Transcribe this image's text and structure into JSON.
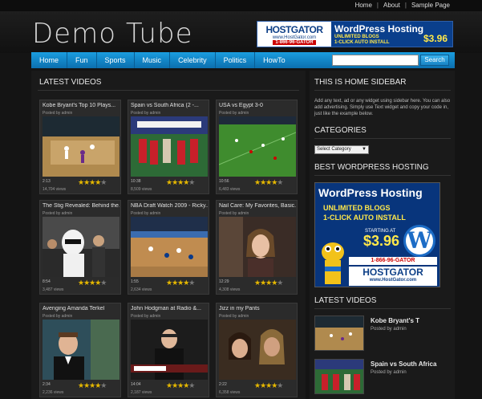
{
  "top_links": [
    "Home",
    "About",
    "Sample Page"
  ],
  "site_title": "Demo Tube",
  "header_ad": {
    "brand": "HOSTGATOR",
    "url": "www.HostGator.com",
    "phone": "1-866-96-GATOR",
    "title": "WordPress Hosting",
    "line1": "UNLIMITED BLOGS",
    "line2": "1-CLICK AUTO INSTALL",
    "price": "$3.96"
  },
  "nav": {
    "items": [
      "Home",
      "Fun",
      "Sports",
      "Music",
      "Celebrity",
      "Politics",
      "HowTo"
    ],
    "search_value": "",
    "search_button": "Search"
  },
  "main": {
    "section_title": "LATEST VIDEOS",
    "videos": [
      {
        "title": "Kobe Bryant's Top 10 Plays...",
        "posted": "Posted by admin",
        "duration": "2:13",
        "views": "14,704 views",
        "rating": 4
      },
      {
        "title": "Spain vs South Africa (2 -...",
        "posted": "Posted by admin",
        "duration": "10:38",
        "views": "8,509 views",
        "rating": 4
      },
      {
        "title": "USA vs Egypt 3-0",
        "posted": "Posted by admin",
        "duration": "10:56",
        "views": "6,483 views",
        "rating": 4
      },
      {
        "title": "The Stig Revealed: Behind the...",
        "posted": "Posted by admin",
        "duration": "8:54",
        "views": "3,487 views",
        "rating": 4
      },
      {
        "title": "NBA Draft Watch 2009 - Ricky...",
        "posted": "Posted by admin",
        "duration": "1:55",
        "views": "2,634 views",
        "rating": 4
      },
      {
        "title": "Nail Care: My Favorites, Basic...",
        "posted": "Posted by admin",
        "duration": "12:29",
        "views": "4,308 views",
        "rating": 4
      },
      {
        "title": "Avenging Amanda Terkel",
        "posted": "Posted by admin",
        "duration": "2:34",
        "views": "2,236 views",
        "rating": 4
      },
      {
        "title": "John Hodgman at Radio &...",
        "posted": "Posted by admin",
        "duration": "14:04",
        "views": "2,187 views",
        "rating": 4
      },
      {
        "title": "Jizz in my Pants",
        "posted": "Posted by admin",
        "duration": "2:22",
        "views": "6,358 views",
        "rating": 4
      }
    ]
  },
  "sidebar": {
    "home_title": "THIS IS HOME SIDEBAR",
    "home_text": "Add any text, ad or any widget using sidebar here. You can also add advertising. Simply use Text widget and copy your code in, just like the example below.",
    "categories_title": "CATEGORIES",
    "category_select": "Select Category",
    "hosting_title": "BEST WORDPRESS HOSTING",
    "ad": {
      "title": "WordPress Hosting",
      "line1": "UNLIMITED BLOGS",
      "line2": "1-CLICK AUTO INSTALL",
      "starting": "STARTING AT",
      "price": "$3.96",
      "phone": "1-866-96-GATOR",
      "brand": "HOSTGATOR",
      "url": "www.HostGator.com",
      "logo_letter": "W"
    },
    "latest_title": "LATEST VIDEOS",
    "latest": [
      {
        "title": "Kobe Bryant's T",
        "posted": "Posted by admin"
      },
      {
        "title": "Spain vs South Africa",
        "posted": "Posted by admin"
      }
    ]
  }
}
